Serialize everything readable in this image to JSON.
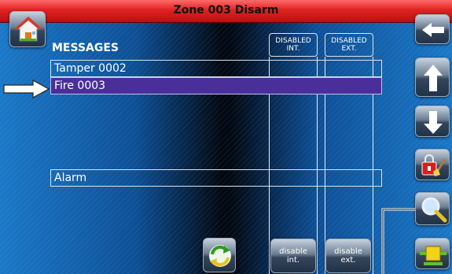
{
  "title": "Zone 003  Disarm",
  "messages_header": "MESSAGES",
  "columns": {
    "disabled_int": "DISABLED\nINT.",
    "disabled_ext": "DISABLED\nEXT."
  },
  "messages": [
    {
      "label": "Tamper 0002",
      "selected": false
    },
    {
      "label": "Fire 0003",
      "selected": true
    },
    {
      "label": "Alarm",
      "selected": false
    }
  ],
  "bottom_buttons": {
    "disable_int": "disable\nint.",
    "disable_ext": "disable\next."
  },
  "icons": {
    "home": "home-icon",
    "back": "arrow-left-icon",
    "up": "arrow-up-icon",
    "down": "arrow-down-icon",
    "lock_clean": "lock-brush-icon",
    "search": "magnifier-icon",
    "confirm": "confirm-icon",
    "refresh": "refresh-icon"
  },
  "colors": {
    "title_bar": "#e02222",
    "selected_row": "#4a2f9a",
    "background": "#0d4f96"
  }
}
